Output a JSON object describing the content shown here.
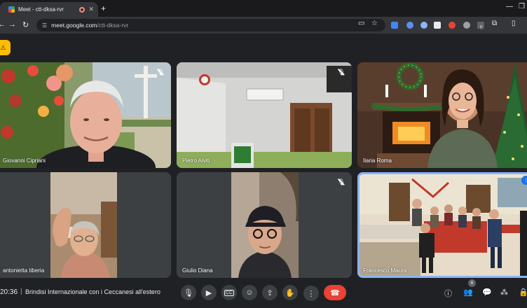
{
  "browser": {
    "tab_title": "Meet - ctt-dksa-rvr",
    "close_glyph": "✕",
    "new_tab_glyph": "+",
    "minimize_glyph": "—",
    "maximize_glyph": "❐",
    "address_host": "meet.google.com",
    "address_path": "/ctt-dksa-rvr"
  },
  "participants": [
    {
      "name": "Giovanni Cipriani",
      "muted": true
    },
    {
      "name": "Pietro Alviti",
      "muted": true
    },
    {
      "name": "Ilaria Roma",
      "muted": false
    },
    {
      "name": "antonietta tiberia",
      "muted": false
    },
    {
      "name": "Giulio Diana",
      "muted": true
    },
    {
      "name": "Francesco Maura",
      "muted": false,
      "speaking": true
    }
  ],
  "meeting": {
    "time": "20:36",
    "separator": "|",
    "name": "Brindisi Internazionale con i Ceccanesi all'estero",
    "people_count": "6"
  },
  "colors": {
    "accent": "#8ab4f8",
    "hangup": "#ea4335",
    "warning": "#fbbc04"
  }
}
